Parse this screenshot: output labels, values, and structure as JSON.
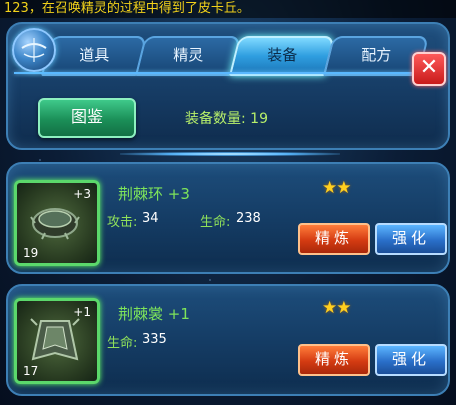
{
  "notice": "123，在召唤精灵的过程中得到了皮卡丘。",
  "tabs": [
    {
      "label": "道具",
      "active": false
    },
    {
      "label": "精灵",
      "active": false
    },
    {
      "label": "装备",
      "active": true
    },
    {
      "label": "配方",
      "active": false
    }
  ],
  "close_label": "✕",
  "atlas_label": "图鉴",
  "count_label": "装备数量: 19",
  "items": [
    {
      "name": "荆棘环 +3",
      "plus": "+3",
      "level": "19",
      "stars": "★★",
      "stats": [
        {
          "label": "攻击:",
          "value": "34"
        },
        {
          "label": "生命:",
          "value": "238"
        }
      ],
      "refine_label": "精炼",
      "enhance_label": "强化"
    },
    {
      "name": "荆棘裳 +1",
      "plus": "+1",
      "level": "17",
      "stars": "★★",
      "stats": [
        {
          "label": "生命:",
          "value": "335"
        }
      ],
      "refine_label": "精炼",
      "enhance_label": "强化"
    }
  ],
  "colors": {
    "accent": "#7ee45a",
    "star": "#ffcf1f",
    "refine": "#d43b12",
    "enhance": "#2a6fc9"
  }
}
